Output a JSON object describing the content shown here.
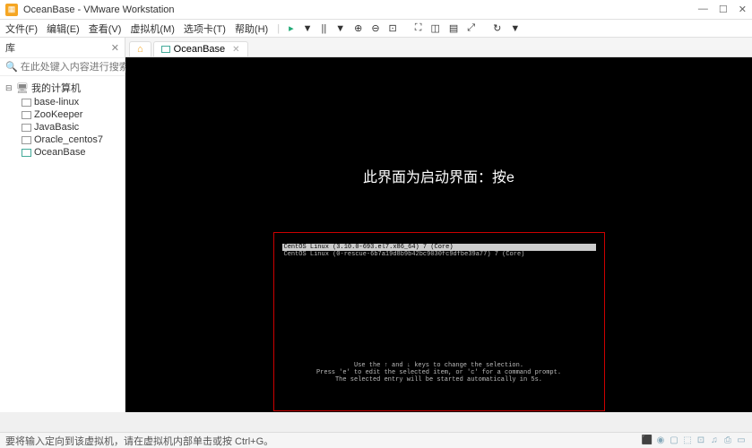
{
  "titlebar": {
    "title": "OceanBase - VMware Workstation"
  },
  "menubar": {
    "file": "文件(F)",
    "edit": "编辑(E)",
    "view": "查看(V)",
    "vm": "虚拟机(M)",
    "tabs": "选项卡(T)",
    "help": "帮助(H)"
  },
  "sidebar": {
    "header": "库",
    "search_placeholder": "在此处键入内容进行搜索",
    "root": "我的计算机",
    "items": [
      "base-linux",
      "ZooKeeper",
      "JavaBasic",
      "Oracle_centos7",
      "OceanBase"
    ]
  },
  "tabs": {
    "active": "OceanBase"
  },
  "vm": {
    "annotation": "此界面为启动界面：按e",
    "boot_selected": "CentOS Linux (3.10.0-693.el7.x86_64) 7 (Core)",
    "boot_other": "CentOS Linux (0-rescue-6b7a19d8b9b42bc9030fc9dfbe39a77) 7 (Core)",
    "hint1": "Use the ↑ and ↓ keys to change the selection.",
    "hint2": "Press 'e' to edit the selected item, or 'c' for a command prompt.",
    "hint3": "The selected entry will be started automatically in 5s."
  },
  "statusbar": {
    "text": "要将输入定向到该虚拟机，请在虚拟机内部单击或按 Ctrl+G。"
  }
}
